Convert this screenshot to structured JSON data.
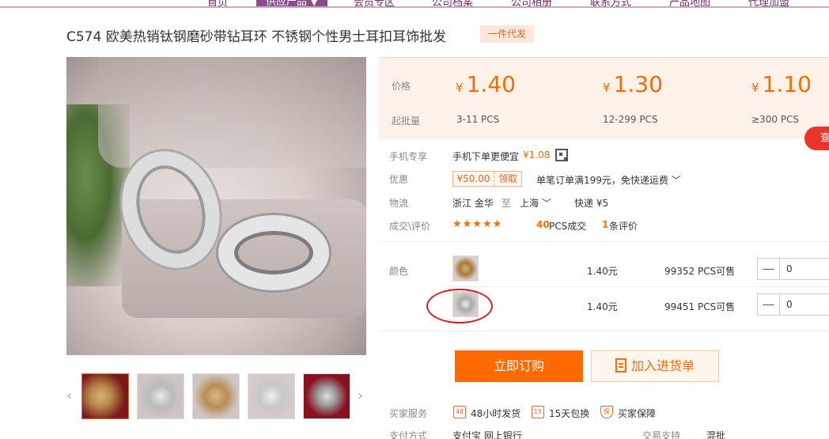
{
  "nav": {
    "items": [
      "首页",
      "供应产品 ▼",
      "会员专区",
      "公司档案",
      "公司相册",
      "联系方式",
      "产品地图",
      "代理加盟"
    ]
  },
  "product": {
    "title": "C574 欧美热销钛钢磨砂带钻耳环 不锈钢个性男士耳扣耳饰批发",
    "tag": "一件代发"
  },
  "pricing": {
    "price_label": "价格",
    "moq_label": "起批量",
    "currency": "¥",
    "tiers": [
      {
        "price": "1.40",
        "moq": "3-11 PCS"
      },
      {
        "price": "1.30",
        "moq": "12-299 PCS"
      },
      {
        "price": "1.10",
        "moq": "≥300 PCS"
      }
    ],
    "search_label": "查"
  },
  "info": {
    "mobile_label": "手机专享",
    "mobile_text": "手机下单更便宜",
    "mobile_price": "¥1.08",
    "promo_label": "优惠",
    "coupon_value": "¥50.00",
    "coupon_action": "领取",
    "promo_text": "单笔订单满199元，免快递运费 ﹀",
    "logistics_label": "物流",
    "origin": "浙江 金华",
    "to": "至",
    "destination": "上海  ﹀",
    "shipping": "快递 ¥5",
    "deals_label": "成交\\评价",
    "stars": "★★★★★",
    "deals_count": "40",
    "deals_unit": "PCS成交",
    "reviews_count": "1",
    "reviews_unit": "条评价"
  },
  "sku": {
    "color_label": "颜色",
    "rows": [
      {
        "price": "1.40元",
        "stock": "99352 PCS可售",
        "qty": "0"
      },
      {
        "price": "1.40元",
        "stock": "99451 PCS可售",
        "qty": "0"
      }
    ],
    "minus": "—"
  },
  "actions": {
    "order": "立即订购",
    "cart": "加入进货单"
  },
  "services": {
    "label": "买家服务",
    "items": [
      {
        "icon": "48",
        "text": "48小时发货"
      },
      {
        "icon": "15",
        "text": "15天包换"
      },
      {
        "icon": "保",
        "text": "买家保障"
      }
    ],
    "payment_label": "支付方式",
    "payment_methods": "支付宝  网上银行",
    "trade_label": "交易支持",
    "trade_value": "混批"
  },
  "colors": {
    "accent": "#ff6a00",
    "nav": "#8e4a8a",
    "circle": "#d92020"
  }
}
